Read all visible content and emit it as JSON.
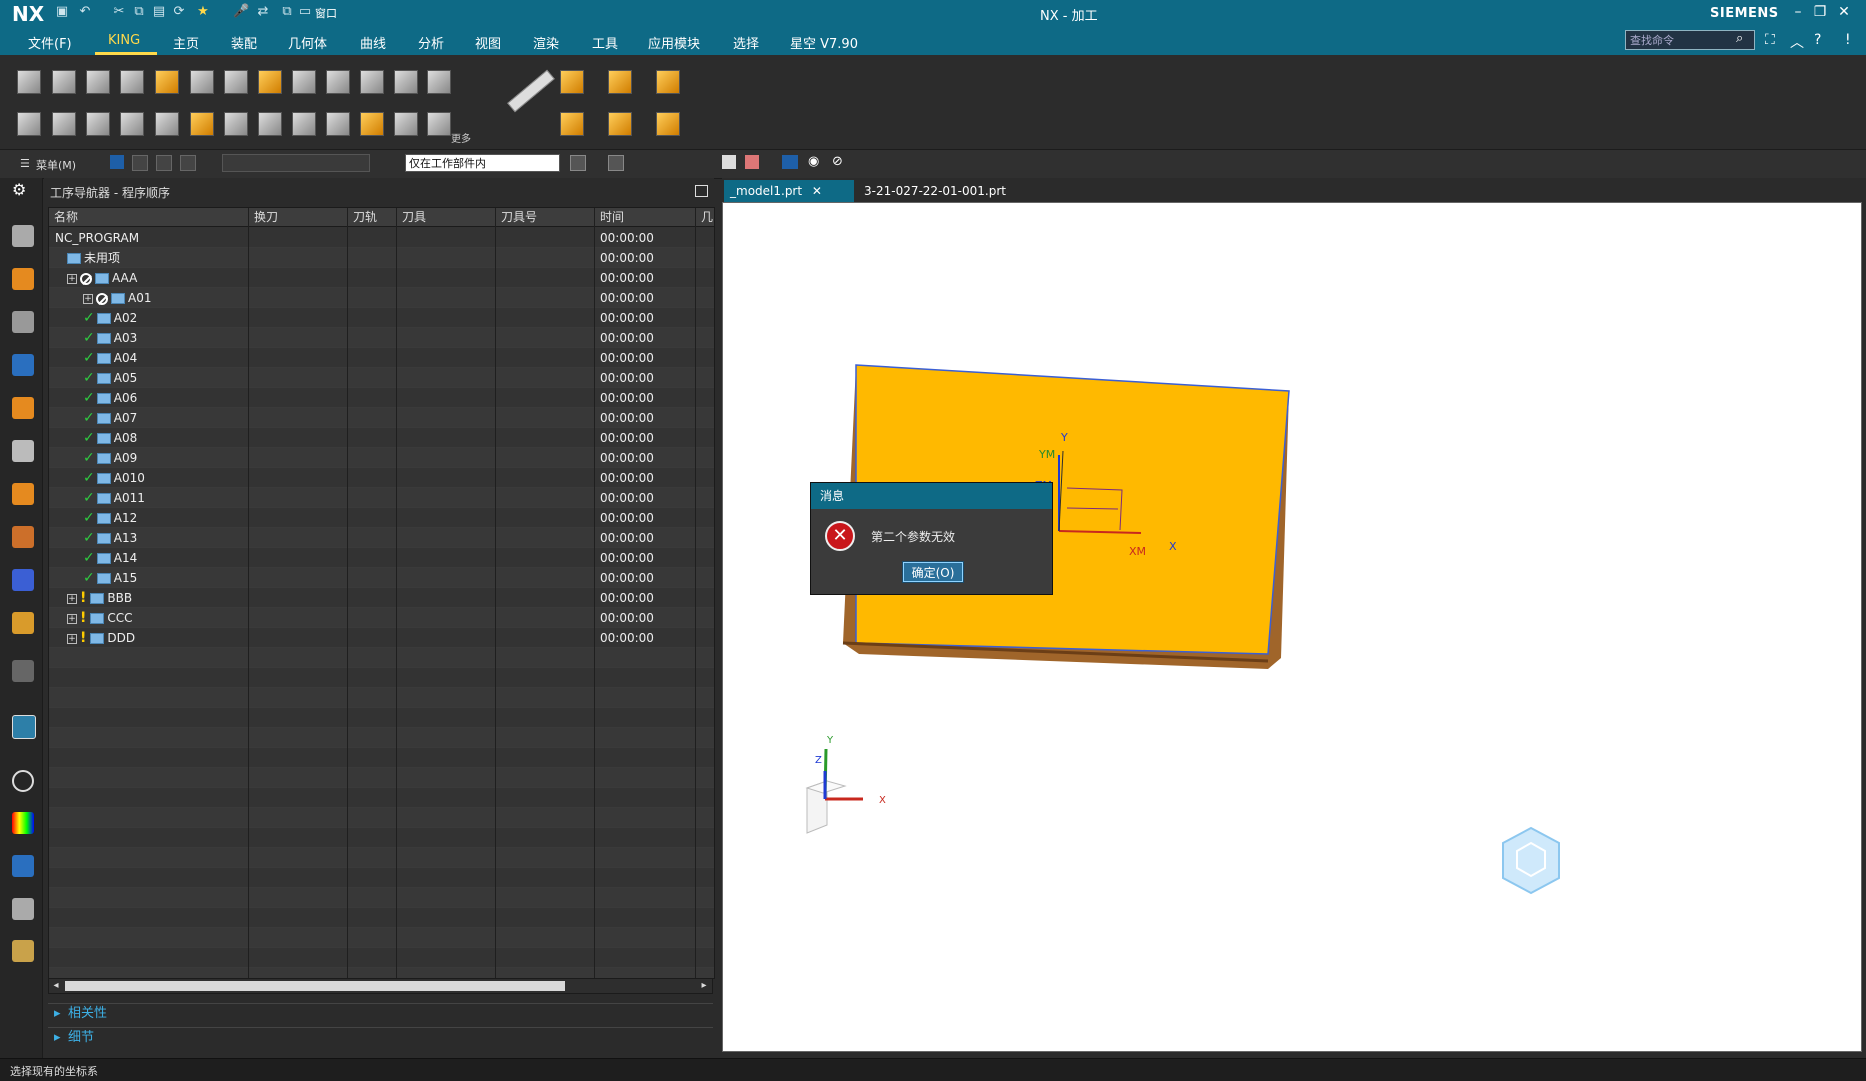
{
  "app": {
    "logo": "NX",
    "title": "NX - 加工",
    "brand": "SIEMENS",
    "window_menu": "窗口"
  },
  "menu": {
    "items": [
      "文件(F)",
      "KING",
      "主页",
      "装配",
      "几何体",
      "曲线",
      "分析",
      "视图",
      "渲染",
      "工具",
      "应用模块",
      "选择",
      "星空 V7.90"
    ],
    "active": "KING",
    "search_placeholder": "查找命令"
  },
  "ribbon": {
    "more_label": "更多"
  },
  "toolbar": {
    "menu_label": "菜单(M)",
    "filter_value": "",
    "scope_value": "仅在工作部件内"
  },
  "navigator": {
    "title": "工序导航器 - 程序顺序",
    "columns": [
      "名称",
      "换刀",
      "刀轨",
      "刀具",
      "刀具号",
      "时间",
      "几"
    ],
    "rows": [
      {
        "name": "NC_PROGRAM",
        "time": "00:00:00",
        "level": 0,
        "status": "none",
        "expand": false
      },
      {
        "name": "未用项",
        "time": "00:00:00",
        "level": 1,
        "status": "none",
        "expand": false
      },
      {
        "name": "AAA",
        "time": "00:00:00",
        "level": 1,
        "status": "forbid",
        "expand": true
      },
      {
        "name": "A01",
        "time": "00:00:00",
        "level": 2,
        "status": "forbid",
        "expand": true
      },
      {
        "name": "A02",
        "time": "00:00:00",
        "level": 2,
        "status": "check",
        "expand": false
      },
      {
        "name": "A03",
        "time": "00:00:00",
        "level": 2,
        "status": "check",
        "expand": false
      },
      {
        "name": "A04",
        "time": "00:00:00",
        "level": 2,
        "status": "check",
        "expand": false
      },
      {
        "name": "A05",
        "time": "00:00:00",
        "level": 2,
        "status": "check",
        "expand": false
      },
      {
        "name": "A06",
        "time": "00:00:00",
        "level": 2,
        "status": "check",
        "expand": false
      },
      {
        "name": "A07",
        "time": "00:00:00",
        "level": 2,
        "status": "check",
        "expand": false
      },
      {
        "name": "A08",
        "time": "00:00:00",
        "level": 2,
        "status": "check",
        "expand": false
      },
      {
        "name": "A09",
        "time": "00:00:00",
        "level": 2,
        "status": "check",
        "expand": false
      },
      {
        "name": "A010",
        "time": "00:00:00",
        "level": 2,
        "status": "check",
        "expand": false
      },
      {
        "name": "A011",
        "time": "00:00:00",
        "level": 2,
        "status": "check",
        "expand": false
      },
      {
        "name": "A12",
        "time": "00:00:00",
        "level": 2,
        "status": "check",
        "expand": false
      },
      {
        "name": "A13",
        "time": "00:00:00",
        "level": 2,
        "status": "check",
        "expand": false
      },
      {
        "name": "A14",
        "time": "00:00:00",
        "level": 2,
        "status": "check",
        "expand": false
      },
      {
        "name": "A15",
        "time": "00:00:00",
        "level": 2,
        "status": "check",
        "expand": false
      },
      {
        "name": "BBB",
        "time": "00:00:00",
        "level": 1,
        "status": "excl",
        "expand": true
      },
      {
        "name": "CCC",
        "time": "00:00:00",
        "level": 1,
        "status": "excl",
        "expand": true
      },
      {
        "name": "DDD",
        "time": "00:00:00",
        "level": 1,
        "status": "excl",
        "expand": true
      }
    ],
    "sections": [
      "相关性",
      "细节"
    ]
  },
  "graphics": {
    "tabs": [
      "_model1.prt",
      "3-21-027-22-01-001.prt"
    ],
    "axis_labels": {
      "y": "Y",
      "ym": "YM",
      "zm": "ZM",
      "x": "X",
      "xm": "XM",
      "z": "Z"
    }
  },
  "dialog": {
    "title": "消息",
    "message": "第二个参数无效",
    "ok": "确定(O)"
  },
  "status": {
    "text": "选择现有的坐标系"
  },
  "colors": {
    "accent": "#0e6a86",
    "active_tab": "#ffd94a",
    "part": "#ffb900",
    "check": "#2ecc40",
    "error": "#c9161b"
  }
}
